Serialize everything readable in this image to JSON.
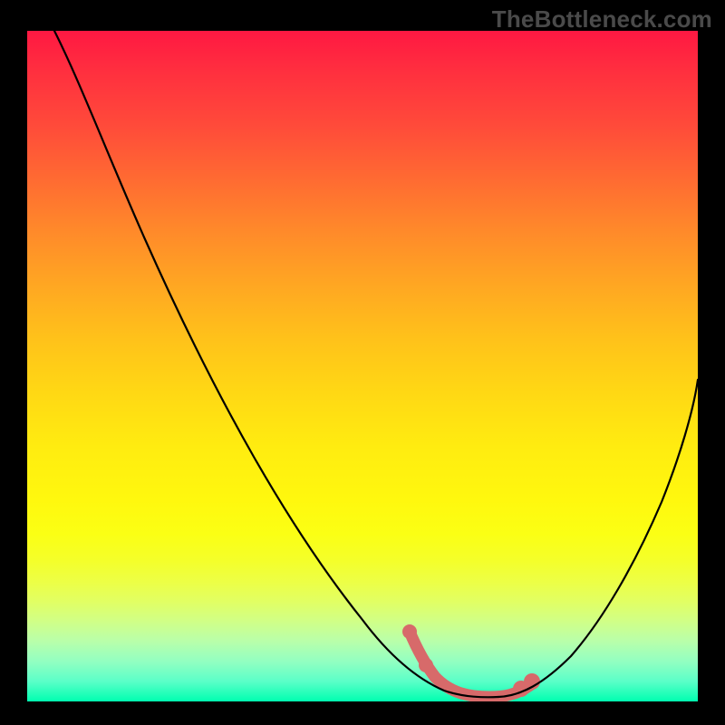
{
  "domain": "Chart",
  "watermark": "TheBottleneck.com",
  "colors": {
    "background": "#000000",
    "curve": "#000000",
    "band": "#d76a6a",
    "gradient_top": "#ff1842",
    "gradient_bottom": "#00ffb0"
  },
  "chart_data": {
    "type": "line",
    "title": "",
    "xlabel": "",
    "ylabel": "",
    "xlim": [
      0,
      100
    ],
    "ylim": [
      0,
      100
    ],
    "x": [
      0,
      5,
      10,
      15,
      20,
      25,
      30,
      35,
      40,
      45,
      50,
      55,
      57,
      60,
      62,
      65,
      68,
      70,
      72,
      75,
      80,
      85,
      90,
      95,
      100
    ],
    "values": [
      100,
      92,
      84,
      76,
      68,
      60,
      52,
      44,
      36,
      28,
      20,
      12,
      9,
      5,
      3,
      1,
      0,
      0,
      0,
      1,
      5,
      12,
      22,
      34,
      48
    ],
    "highlight_band_x": [
      57,
      75
    ],
    "highlight_dots_x": [
      57,
      60,
      72,
      74
    ]
  }
}
